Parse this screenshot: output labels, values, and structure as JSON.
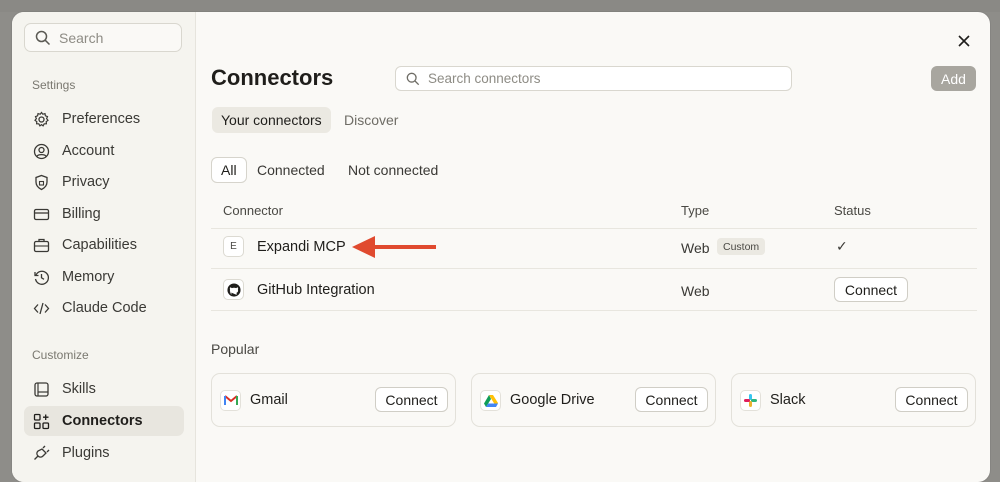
{
  "sidebar": {
    "search_placeholder": "Search",
    "settings_label": "Settings",
    "settings_items": [
      {
        "label": "Preferences"
      },
      {
        "label": "Account"
      },
      {
        "label": "Privacy"
      },
      {
        "label": "Billing"
      },
      {
        "label": "Capabilities"
      },
      {
        "label": "Memory"
      },
      {
        "label": "Claude Code"
      }
    ],
    "customize_label": "Customize",
    "customize_items": [
      {
        "label": "Skills"
      },
      {
        "label": "Connectors"
      },
      {
        "label": "Plugins"
      }
    ]
  },
  "main": {
    "title": "Connectors",
    "search_placeholder": "Search connectors",
    "add_label": "Add",
    "tabs": [
      {
        "label": "Your connectors"
      },
      {
        "label": "Discover"
      }
    ],
    "filters": [
      {
        "label": "All"
      },
      {
        "label": "Connected"
      },
      {
        "label": "Not connected"
      }
    ],
    "table": {
      "headers": [
        "Connector",
        "Type",
        "Status"
      ],
      "rows": [
        {
          "icon_letter": "E",
          "name": "Expandi MCP",
          "type": "Web",
          "badge": "Custom",
          "status": "✓"
        },
        {
          "icon": "github-icon",
          "name": "GitHub Integration",
          "type": "Web",
          "action": "Connect"
        }
      ]
    },
    "popular_label": "Popular",
    "popular": [
      {
        "name": "Gmail",
        "icon": "gmail-icon",
        "action": "Connect"
      },
      {
        "name": "Google Drive",
        "icon": "google-drive-icon",
        "action": "Connect"
      },
      {
        "name": "Slack",
        "icon": "slack-icon",
        "action": "Connect"
      }
    ]
  },
  "colors": {
    "annotation_arrow": "#e04a2f",
    "active_bg": "#e8e6df"
  }
}
